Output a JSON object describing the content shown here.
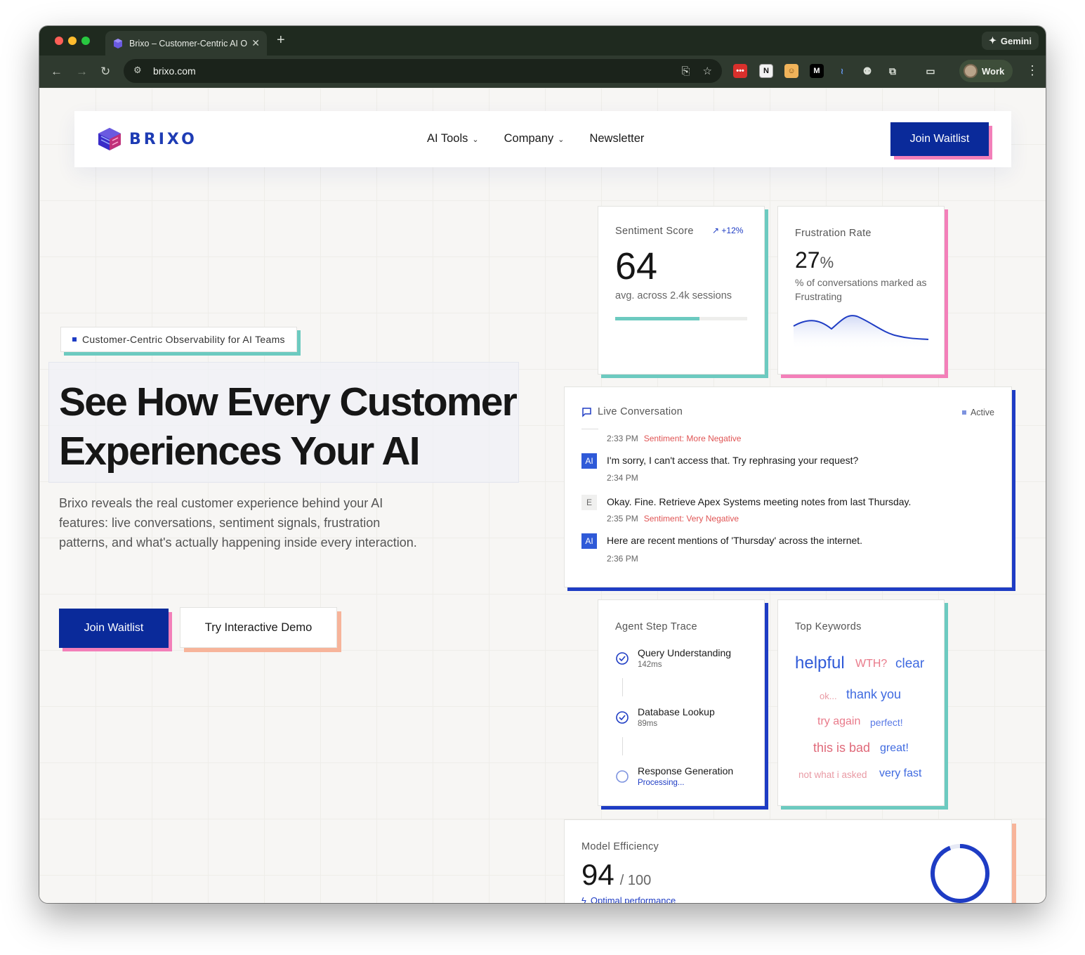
{
  "browser": {
    "tab_title": "Brixo – Customer-Centric AI O",
    "url": "brixo.com",
    "gemini_label": "Gemini",
    "profile_label": "Work"
  },
  "nav": {
    "logo_text": "BRIXO",
    "menu": [
      {
        "label": "AI Tools"
      },
      {
        "label": "Company"
      },
      {
        "label": "Newsletter"
      }
    ],
    "cta": "Join Waitlist"
  },
  "hero": {
    "badge": "Customer-Centric Observability for AI Teams",
    "headline_line1": "See How Every Customer",
    "headline_line2": "Experiences Your AI",
    "subtitle": "Brixo reveals the real customer experience behind your AI features: live conversations, sentiment signals, frustration patterns, and what's actually happening inside every interaction.",
    "primary_cta": "Join Waitlist",
    "secondary_cta": "Try Interactive Demo"
  },
  "sentiment": {
    "label": "Sentiment Score",
    "trend": "+12%",
    "value": "64",
    "caption": "avg. across 2.4k sessions",
    "progress": 0.64
  },
  "frustration": {
    "label": "Frustration Rate",
    "value": "27",
    "unit": "%",
    "caption": "% of conversations marked as Frustrating"
  },
  "conversation": {
    "label": "Live Conversation",
    "status": "Active",
    "messages": [
      {
        "time": "2:33 PM",
        "sentiment": "Sentiment: More Negative"
      },
      {
        "role": "AI",
        "text": "I'm sorry, I can't access that. Try rephrasing your request?",
        "time": "2:34 PM",
        "sentiment": ""
      },
      {
        "role": "E",
        "text": "Okay. Fine. Retrieve Apex Systems meeting notes from last Thursday.",
        "time": "2:35 PM",
        "sentiment": "Sentiment: Very Negative"
      },
      {
        "role": "AI",
        "text": "Here are recent mentions of 'Thursday' across the internet.",
        "time": "2:36 PM",
        "sentiment": ""
      }
    ]
  },
  "trace": {
    "label": "Agent Step Trace",
    "steps": [
      {
        "name": "Query Understanding",
        "detail": "142ms"
      },
      {
        "name": "Database Lookup",
        "detail": "89ms"
      },
      {
        "name": "Response Generation",
        "detail": "Processing..."
      }
    ]
  },
  "keywords": {
    "label": "Top Keywords",
    "items": [
      "helpful",
      "WTH?",
      "clear",
      "ok...",
      "thank you",
      "try again",
      "perfect!",
      "this is bad",
      "great!",
      "not what i asked",
      "very fast"
    ]
  },
  "efficiency": {
    "label": "Model Efficiency",
    "value": "94",
    "max": "/ 100",
    "status": "Optimal performance"
  },
  "colors": {
    "primary": "#0a2a9a",
    "accent_blue": "#1e3cc4",
    "pink": "#f37fb9",
    "teal": "#6ccac0",
    "peach": "#f7b49a",
    "negative": "#e05454"
  }
}
